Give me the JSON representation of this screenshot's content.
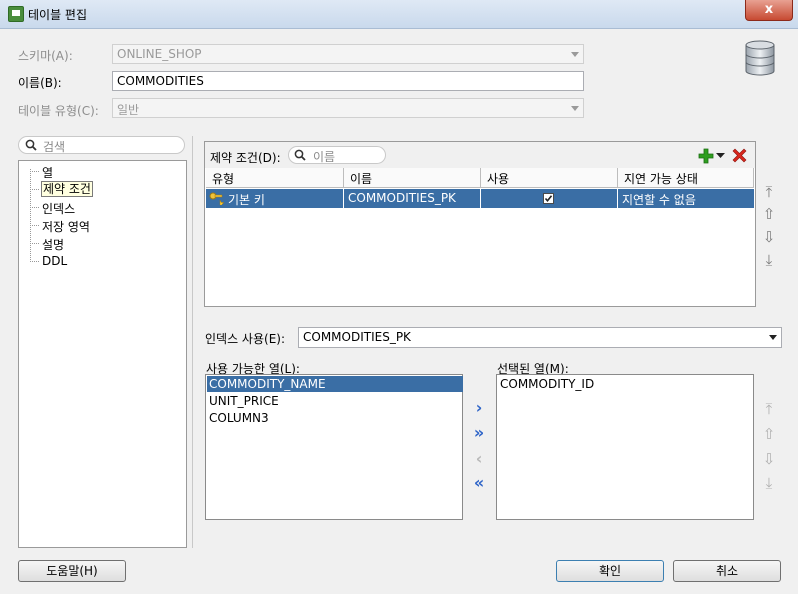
{
  "window": {
    "title": "테이블 편집",
    "close_label": "x"
  },
  "form": {
    "schema_label": "스키마(A):",
    "schema_value": "ONLINE_SHOP",
    "name_label": "이름(B):",
    "name_value": "COMMODITIES",
    "type_label": "테이블 유형(C):",
    "type_value": "일반"
  },
  "tree": {
    "search_placeholder": "검색",
    "items": [
      "열",
      "제약 조건",
      "인덱스",
      "저장 영역",
      "설명",
      "DDL"
    ],
    "selected_index": 1
  },
  "constraints": {
    "label": "제약 조건(D):",
    "filter_placeholder": "이름",
    "columns": [
      "유형",
      "이름",
      "사용",
      "지연 가능 상태"
    ],
    "rows": [
      {
        "type": "기본 키",
        "name": "COMMODITIES_PK",
        "enabled": true,
        "deferrable": "지연할 수 없음"
      }
    ],
    "add_icon": "plus-icon",
    "delete_icon": "red-x-icon"
  },
  "index": {
    "label": "인덱스 사용(E):",
    "value": "COMMODITIES_PK"
  },
  "available": {
    "label": "사용 가능한 열(L):",
    "items": [
      "COMMODITY_NAME",
      "UNIT_PRICE",
      "COLUMN3"
    ],
    "selected_index": 0
  },
  "selected": {
    "label": "선택된 열(M):",
    "items": [
      "COMMODITY_ID"
    ]
  },
  "buttons": {
    "help": "도움말(H)",
    "ok": "확인",
    "cancel": "취소"
  },
  "colors": {
    "selection": "#3a6ea5",
    "accent_green": "#2e9e1f",
    "delete_red": "#d8261c"
  }
}
